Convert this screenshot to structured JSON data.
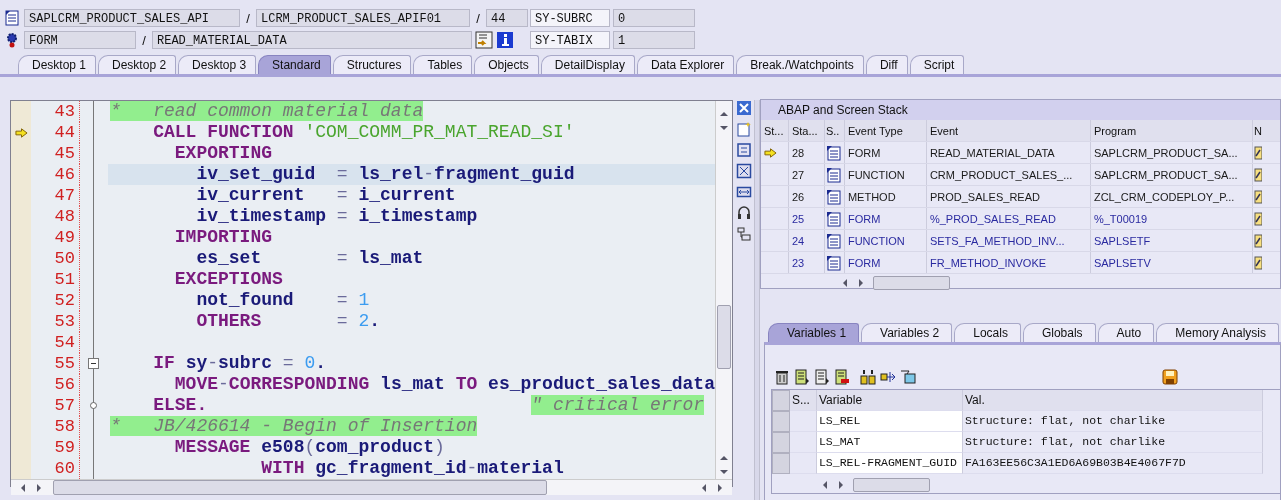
{
  "header": {
    "program": "SAPLCRM_PRODUCT_SALES_API",
    "program_separator": "/",
    "include": "LCRM_PRODUCT_SALES_APIF01",
    "include_separator": "/",
    "line": "44",
    "event_type": "FORM",
    "event_separator": "/",
    "event": "READ_MATERIAL_DATA",
    "system_fields": [
      {
        "name": "SY-SUBRC",
        "value": "0"
      },
      {
        "name": "SY-TABIX",
        "value": "1"
      }
    ]
  },
  "tabs": [
    {
      "label": "Desktop 1",
      "selected": false
    },
    {
      "label": "Desktop 2",
      "selected": false
    },
    {
      "label": "Desktop 3",
      "selected": false
    },
    {
      "label": "Standard",
      "selected": true
    },
    {
      "label": "Structures",
      "selected": false
    },
    {
      "label": "Tables",
      "selected": false
    },
    {
      "label": "Objects",
      "selected": false
    },
    {
      "label": "DetailDisplay",
      "selected": false
    },
    {
      "label": "Data Explorer",
      "selected": false
    },
    {
      "label": "Break./Watchpoints",
      "selected": false
    },
    {
      "label": "Diff",
      "selected": false
    },
    {
      "label": "Script",
      "selected": false
    }
  ],
  "editor": {
    "lines": [
      {
        "number": "43",
        "marker": false,
        "highlighted": false,
        "tokens": [
          {
            "kind": "comment",
            "text": "*   read common material data"
          }
        ]
      },
      {
        "number": "44",
        "marker": true,
        "highlighted": false,
        "tokens": [
          {
            "kind": "keyword",
            "text": "    CALL FUNCTION "
          },
          {
            "kind": "string",
            "text": "'COM_COMM_PR_MAT_READ_SI'"
          }
        ]
      },
      {
        "number": "45",
        "marker": false,
        "highlighted": false,
        "tokens": [
          {
            "kind": "keyword",
            "text": "      EXPORTING"
          }
        ]
      },
      {
        "number": "46",
        "marker": false,
        "highlighted": true,
        "tokens": [
          {
            "kind": "ident",
            "text": "        iv_set_guid"
          },
          {
            "kind": "op",
            "text": "  = "
          },
          {
            "kind": "ident",
            "text": "ls_rel"
          },
          {
            "kind": "op",
            "text": "-"
          },
          {
            "kind": "ident",
            "text": "fragment_guid"
          }
        ]
      },
      {
        "number": "47",
        "marker": false,
        "highlighted": false,
        "tokens": [
          {
            "kind": "ident",
            "text": "        iv_current"
          },
          {
            "kind": "op",
            "text": "   = "
          },
          {
            "kind": "ident",
            "text": "i_current"
          }
        ]
      },
      {
        "number": "48",
        "marker": false,
        "highlighted": false,
        "tokens": [
          {
            "kind": "ident",
            "text": "        iv_timestamp"
          },
          {
            "kind": "op",
            "text": " = "
          },
          {
            "kind": "ident",
            "text": "i_timestamp"
          }
        ]
      },
      {
        "number": "49",
        "marker": false,
        "highlighted": false,
        "tokens": [
          {
            "kind": "keyword",
            "text": "      IMPORTING"
          }
        ]
      },
      {
        "number": "50",
        "marker": false,
        "highlighted": false,
        "tokens": [
          {
            "kind": "ident",
            "text": "        es_set"
          },
          {
            "kind": "op",
            "text": "       = "
          },
          {
            "kind": "ident",
            "text": "ls_mat"
          }
        ]
      },
      {
        "number": "51",
        "marker": false,
        "highlighted": false,
        "tokens": [
          {
            "kind": "keyword",
            "text": "      EXCEPTIONS"
          }
        ]
      },
      {
        "number": "52",
        "marker": false,
        "highlighted": false,
        "tokens": [
          {
            "kind": "ident",
            "text": "        not_found"
          },
          {
            "kind": "op",
            "text": "    = "
          },
          {
            "kind": "number",
            "text": "1"
          }
        ]
      },
      {
        "number": "53",
        "marker": false,
        "highlighted": false,
        "tokens": [
          {
            "kind": "keyword",
            "text": "        OTHERS"
          },
          {
            "kind": "op",
            "text": "       = "
          },
          {
            "kind": "number",
            "text": "2"
          },
          {
            "kind": "ident",
            "text": "."
          }
        ]
      },
      {
        "number": "54",
        "marker": false,
        "highlighted": false
      },
      {
        "number": "55",
        "marker": false,
        "highlighted": false,
        "kind": "fold-start",
        "tokens": [
          {
            "kind": "keyword",
            "text": "    IF "
          },
          {
            "kind": "ident",
            "text": "sy"
          },
          {
            "kind": "op",
            "text": "-"
          },
          {
            "kind": "ident",
            "text": "subrc"
          },
          {
            "kind": "op",
            "text": " = "
          },
          {
            "kind": "number",
            "text": "0"
          },
          {
            "kind": "ident",
            "text": "."
          }
        ]
      },
      {
        "number": "56",
        "marker": false,
        "highlighted": false,
        "tokens": [
          {
            "kind": "keyword",
            "text": "      MOVE"
          },
          {
            "kind": "op",
            "text": "-"
          },
          {
            "kind": "keyword",
            "text": "CORRESPONDING "
          },
          {
            "kind": "ident",
            "text": "ls_mat "
          },
          {
            "kind": "keyword",
            "text": "TO "
          },
          {
            "kind": "ident",
            "text": "es_product_sales_data"
          }
        ]
      },
      {
        "number": "57",
        "marker": false,
        "highlighted": false,
        "kind": "fold-end",
        "tokens": [
          {
            "kind": "keyword",
            "text": "    ELSE.                              "
          },
          {
            "kind": "comment",
            "text": "\" critical error"
          }
        ]
      },
      {
        "number": "58",
        "marker": false,
        "highlighted": false,
        "tokens": [
          {
            "kind": "comment",
            "text": "*   JB/426614 - Begin of Insertion"
          }
        ]
      },
      {
        "number": "59",
        "marker": false,
        "highlighted": false,
        "tokens": [
          {
            "kind": "keyword",
            "text": "      MESSAGE "
          },
          {
            "kind": "ident",
            "text": "e508"
          },
          {
            "kind": "op",
            "text": "("
          },
          {
            "kind": "ident",
            "text": "com_product"
          },
          {
            "kind": "op",
            "text": ")"
          }
        ]
      },
      {
        "number": "60",
        "marker": false,
        "highlighted": false,
        "tokens": [
          {
            "kind": "keyword",
            "text": "              WITH "
          },
          {
            "kind": "ident",
            "text": "gc_fragment_id"
          },
          {
            "kind": "op",
            "text": "-"
          },
          {
            "kind": "ident",
            "text": "material"
          }
        ]
      }
    ]
  },
  "stack": {
    "title": "ABAP and Screen Stack",
    "columns": [
      "St...",
      "Sta...",
      "S..",
      "Event Type",
      "Event",
      "Program",
      "N"
    ],
    "rows": [
      {
        "current": true,
        "stack_level": "28",
        "event_type": "FORM",
        "event": "READ_MATERIAL_DATA",
        "program": "SAPLCRM_PRODUCT_SA...",
        "color": "#1a1a1a"
      },
      {
        "current": false,
        "stack_level": "27",
        "event_type": "FUNCTION",
        "event": "CRM_PRODUCT_SALES_...",
        "program": "SAPLCRM_PRODUCT_SA...",
        "color": "#1a1a1a"
      },
      {
        "current": false,
        "stack_level": "26",
        "event_type": "METHOD",
        "event": "PROD_SALES_READ",
        "program": "ZCL_CRM_CODEPLOY_P...",
        "color": "#1a1a1a"
      },
      {
        "current": false,
        "stack_level": "25",
        "event_type": "FORM",
        "event": "%_PROD_SALES_READ",
        "program": "%_T00019",
        "color": "#2a2aa0"
      },
      {
        "current": false,
        "stack_level": "24",
        "event_type": "FUNCTION",
        "event": "SETS_FA_METHOD_INV...",
        "program": "SAPLSETF",
        "color": "#2a2aa0"
      },
      {
        "current": false,
        "stack_level": "23",
        "event_type": "FORM",
        "event": "FR_METHOD_INVOKE",
        "program": "SAPLSETV",
        "color": "#2a2aa0"
      }
    ]
  },
  "variables": {
    "tabs": [
      {
        "label": "Variables 1",
        "selected": true
      },
      {
        "label": "Variables 2",
        "selected": false
      },
      {
        "label": "Locals",
        "selected": false
      },
      {
        "label": "Globals",
        "selected": false
      },
      {
        "label": "Auto",
        "selected": false
      },
      {
        "label": "Memory Analysis",
        "selected": false
      }
    ],
    "columns": [
      "S...",
      "Variable",
      "Val."
    ],
    "rows": [
      {
        "variable": "LS_REL",
        "value": "Structure: flat, not charlike"
      },
      {
        "variable": "LS_MAT",
        "value": "Structure: flat, not charlike"
      },
      {
        "variable": "LS_REL-FRAGMENT_GUID",
        "value": "FA163EE56C3A1ED6A69B03B4E4067F7D"
      }
    ]
  }
}
